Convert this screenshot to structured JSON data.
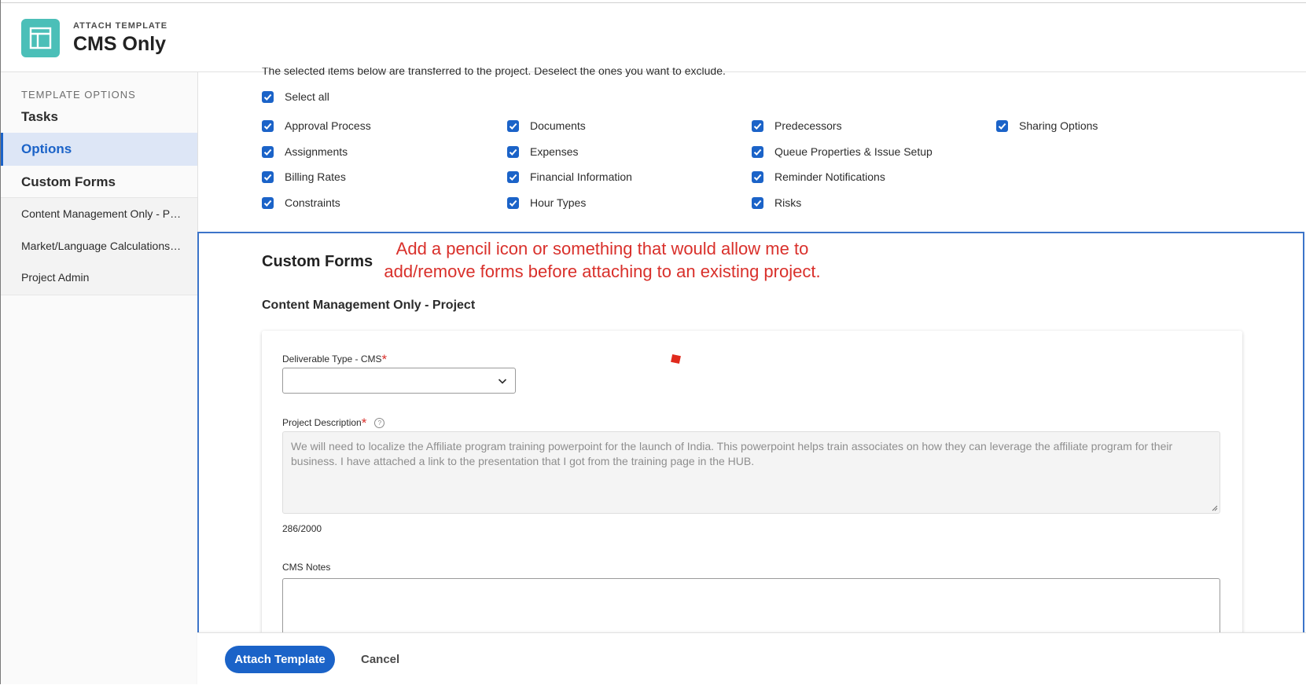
{
  "header": {
    "eyebrow": "ATTACH TEMPLATE",
    "title": "CMS Only",
    "logo_icon": "template-layout-icon"
  },
  "sidebar": {
    "group_label": "TEMPLATE OPTIONS",
    "items": [
      {
        "label": "Tasks",
        "active": false
      },
      {
        "label": "Options",
        "active": true
      },
      {
        "label": "Custom Forms",
        "active": false
      }
    ],
    "subitems": [
      {
        "label": "Content Management Only - Project"
      },
      {
        "label": "Market/Language Calculations Project"
      },
      {
        "label": "Project Admin"
      }
    ]
  },
  "options": {
    "intro": "The selected items below are transferred to the project. Deselect the ones you want to exclude.",
    "select_all": {
      "label": "Select all",
      "checked": true
    },
    "items": [
      {
        "label": "Approval Process",
        "checked": true
      },
      {
        "label": "Assignments",
        "checked": true
      },
      {
        "label": "Billing Rates",
        "checked": true
      },
      {
        "label": "Constraints",
        "checked": true
      },
      {
        "label": "Documents",
        "checked": true
      },
      {
        "label": "Expenses",
        "checked": true
      },
      {
        "label": "Financial Information",
        "checked": true
      },
      {
        "label": "Hour Types",
        "checked": true
      },
      {
        "label": "Predecessors",
        "checked": true
      },
      {
        "label": "Queue Properties & Issue Setup",
        "checked": true
      },
      {
        "label": "Reminder Notifications",
        "checked": true
      },
      {
        "label": "Risks",
        "checked": true
      },
      {
        "label": "Sharing Options",
        "checked": true
      }
    ]
  },
  "custom_forms": {
    "title": "Custom Forms",
    "annotation": "Add a pencil icon or something that would allow me to add/remove forms before attaching to an existing project.",
    "form_name": "Content Management Only - Project",
    "fields": {
      "deliverable_type": {
        "label": "Deliverable Type - CMS",
        "required_mark": "*",
        "value": ""
      },
      "project_description": {
        "label": "Project Description",
        "required_mark": "*",
        "value": "We will need to localize the Affiliate program training powerpoint for the launch of India. This powerpoint helps train associates on how they can leverage the affiliate program for their business. I have attached a link to the presentation that I got from the training page in the HUB.",
        "char_count": "286/2000"
      },
      "cms_notes": {
        "label": "CMS Notes",
        "value": ""
      }
    }
  },
  "footer": {
    "attach_label": "Attach Template",
    "cancel_label": "Cancel"
  },
  "colors": {
    "accent": "#1b63c8",
    "logo": "#4bbfb8",
    "annotation": "#d9302b"
  }
}
